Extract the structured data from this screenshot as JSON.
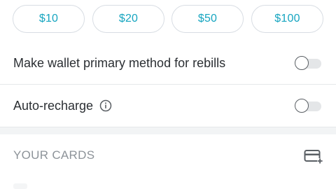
{
  "amounts": [
    "$10",
    "$20",
    "$50",
    "$100"
  ],
  "settings": {
    "primary_wallet": {
      "label": "Make wallet primary method for rebills",
      "enabled": false
    },
    "auto_recharge": {
      "label": "Auto-recharge",
      "enabled": false
    }
  },
  "cards_section": {
    "title": "YOUR CARDS"
  },
  "icons": {
    "info": "info-circle-icon",
    "add_card": "add-card-icon"
  },
  "colors": {
    "accent": "#16a5c0",
    "label": "#2b2f33",
    "muted": "#8d9399"
  }
}
